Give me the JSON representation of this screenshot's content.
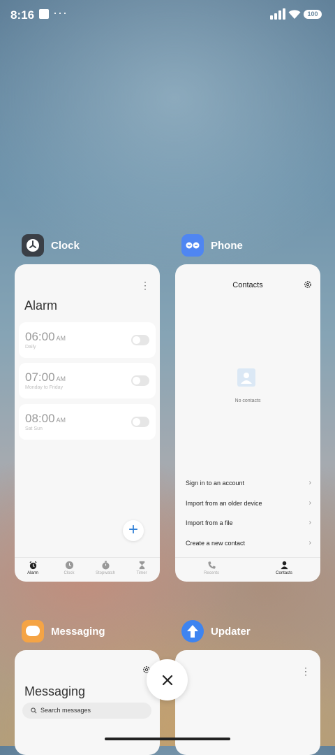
{
  "status_bar": {
    "time": "8:16",
    "dots": "···",
    "battery": "100"
  },
  "apps": [
    {
      "name": "Clock",
      "screen": {
        "more": "⋮",
        "title": "Alarm",
        "alarms": [
          {
            "time": "06:00",
            "ampm": "AM",
            "repeat": "Daily"
          },
          {
            "time": "07:00",
            "ampm": "AM",
            "repeat": "Monday to Friday"
          },
          {
            "time": "08:00",
            "ampm": "AM",
            "repeat": "Sat Sun"
          }
        ],
        "fab": "+",
        "nav": [
          "Alarm",
          "Clock",
          "Stopwatch",
          "Timer"
        ]
      }
    },
    {
      "name": "Phone",
      "screen": {
        "title": "Contacts",
        "empty": "No contacts",
        "menu": [
          "Sign in to an account",
          "Import from an older device",
          "Import from a file",
          "Create a new contact"
        ],
        "chevron": "›",
        "nav": [
          "Recents",
          "Contacts"
        ]
      }
    },
    {
      "name": "Messaging",
      "screen": {
        "title": "Messaging",
        "search_placeholder": "Search messages"
      }
    },
    {
      "name": "Updater",
      "screen": {
        "more": "⋮"
      }
    }
  ],
  "close_button": "✕",
  "icons": {
    "clock": "clock-icon",
    "phone": "phone-icon",
    "messaging": "message-icon",
    "updater": "arrow-up-icon",
    "gear": "gear-icon",
    "search": "search-icon"
  },
  "colors": {
    "clock_icon_bg": "#3a3f46",
    "phone_icon_bg": "#4f86f2",
    "messaging_icon_bg": "#f5a445",
    "updater_icon_bg": "#3e84f0",
    "accent_blue": "#2f7fd6"
  }
}
